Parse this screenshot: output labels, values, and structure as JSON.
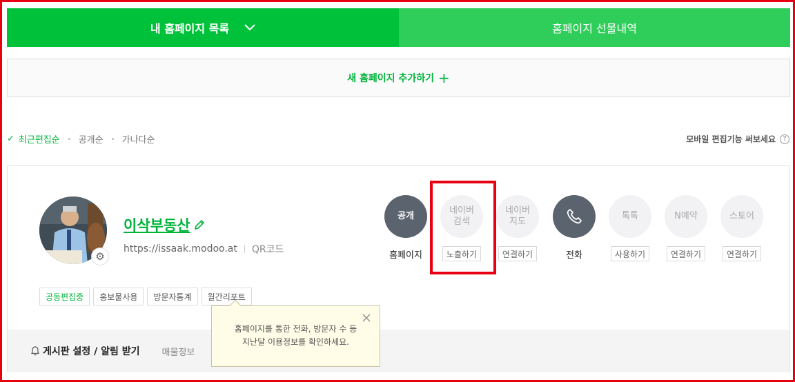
{
  "tabs": {
    "my_pages": "내 홈페이지 목록",
    "gift_history": "홈페이지 선물내역"
  },
  "add_page": {
    "label": "새 홈페이지 추가하기",
    "plus": "+"
  },
  "sort": {
    "check": "✓",
    "options": [
      "최근편집순",
      "공개순",
      "가나다순"
    ],
    "active": "최근편집순"
  },
  "mobile_tip": {
    "label": "모바일 편집기능 써보세요",
    "help": "?"
  },
  "site": {
    "name": "이삭부동산",
    "url": "https://issaak.modoo.at",
    "qr_label": "QR코드",
    "tags": [
      "공동편집중",
      "홍보물사용",
      "방문자통계",
      "월간리포트"
    ]
  },
  "services": [
    {
      "icon_text": "공개",
      "label": "홈페이지",
      "style": "dark"
    },
    {
      "icon_text": "네이버\n검색",
      "button": "노출하기",
      "style": "light"
    },
    {
      "icon_text": "네이버\n지도",
      "button": "연결하기",
      "style": "light"
    },
    {
      "icon": "phone-icon",
      "label": "전화",
      "style": "dark"
    },
    {
      "icon_text": "톡톡",
      "button": "사용하기",
      "style": "light"
    },
    {
      "icon_text": "N예약",
      "button": "연결하기",
      "style": "light"
    },
    {
      "icon_text": "스토어",
      "button": "연결하기",
      "style": "light"
    }
  ],
  "board": {
    "title": "게시판 설정 / 알림 받기",
    "sub": "매물정보"
  },
  "tooltip": {
    "line1": "홈페이지를 통한 전화, 방문자 수 등",
    "line2": "지난달 이용정보를 확인하세요."
  },
  "colors": {
    "accent": "#00c13a",
    "accent_light": "#2fcd5a",
    "highlight": "#e60012",
    "dark_circle": "#5b636f"
  }
}
